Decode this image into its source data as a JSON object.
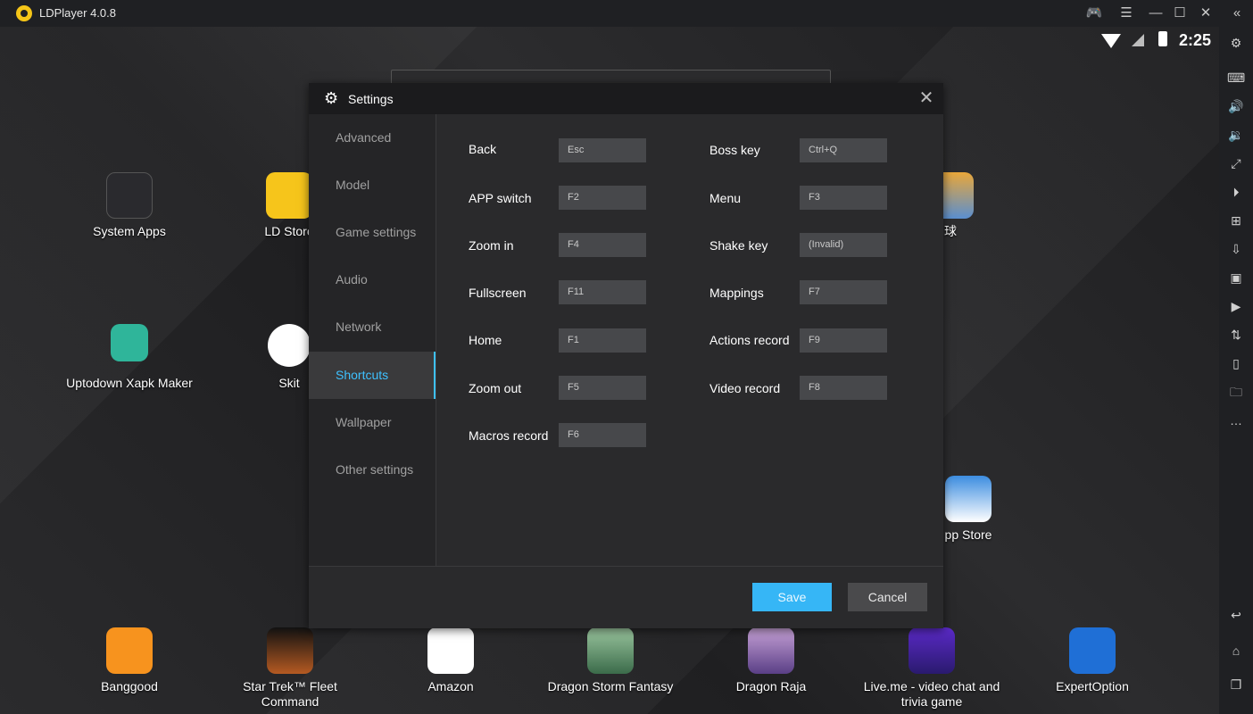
{
  "window": {
    "title": "LDPlayer 4.0.8"
  },
  "status": {
    "time": "2:25"
  },
  "desktop_apps": [
    {
      "label": "System Apps",
      "icon": "system-apps-icon"
    },
    {
      "label": "LD Store",
      "icon": "ld-store-icon"
    },
    {
      "label": "球",
      "icon": "game-icon"
    },
    {
      "label": "Uptodown Xapk Maker",
      "icon": "android-icon"
    },
    {
      "label": "Skit",
      "icon": "skit-icon"
    },
    {
      "label": "pp Store",
      "icon": "app-store-icon"
    }
  ],
  "dock_apps": [
    {
      "label": "Banggood",
      "icon": "banggood-icon"
    },
    {
      "label": "Star Trek™ Fleet Command",
      "icon": "star-trek-icon"
    },
    {
      "label": "Amazon",
      "icon": "amazon-icon"
    },
    {
      "label": "Dragon Storm Fantasy",
      "icon": "dragon-storm-icon"
    },
    {
      "label": "Dragon Raja",
      "icon": "dragon-raja-icon"
    },
    {
      "label": "Live.me - video chat and trivia game",
      "icon": "liveme-icon"
    },
    {
      "label": "ExpertOption",
      "icon": "expertoption-icon"
    }
  ],
  "dialog": {
    "title": "Settings",
    "nav": [
      "Advanced",
      "Model",
      "Game settings",
      "Audio",
      "Network",
      "Shortcuts",
      "Wallpaper",
      "Other settings"
    ],
    "active_nav": "Shortcuts",
    "shortcuts_left": [
      {
        "label": "Back",
        "key": "Esc"
      },
      {
        "label": "APP switch",
        "key": "F2"
      },
      {
        "label": "Zoom in",
        "key": "F4"
      },
      {
        "label": "Fullscreen",
        "key": "F11"
      },
      {
        "label": "Home",
        "key": "F1"
      },
      {
        "label": "Zoom out",
        "key": "F5"
      },
      {
        "label": "Macros record",
        "key": "F6"
      }
    ],
    "shortcuts_right": [
      {
        "label": "Boss key",
        "key": "Ctrl+Q"
      },
      {
        "label": "Menu",
        "key": "F3"
      },
      {
        "label": "Shake key",
        "key": "(Invalid)"
      },
      {
        "label": "Mappings",
        "key": "F7"
      },
      {
        "label": "Actions record",
        "key": "F9"
      },
      {
        "label": "Video record",
        "key": "F8"
      }
    ],
    "save_label": "Save",
    "cancel_label": "Cancel"
  },
  "colors": {
    "accent": "#36b6f6",
    "active_nav": "#3ec1ff"
  }
}
